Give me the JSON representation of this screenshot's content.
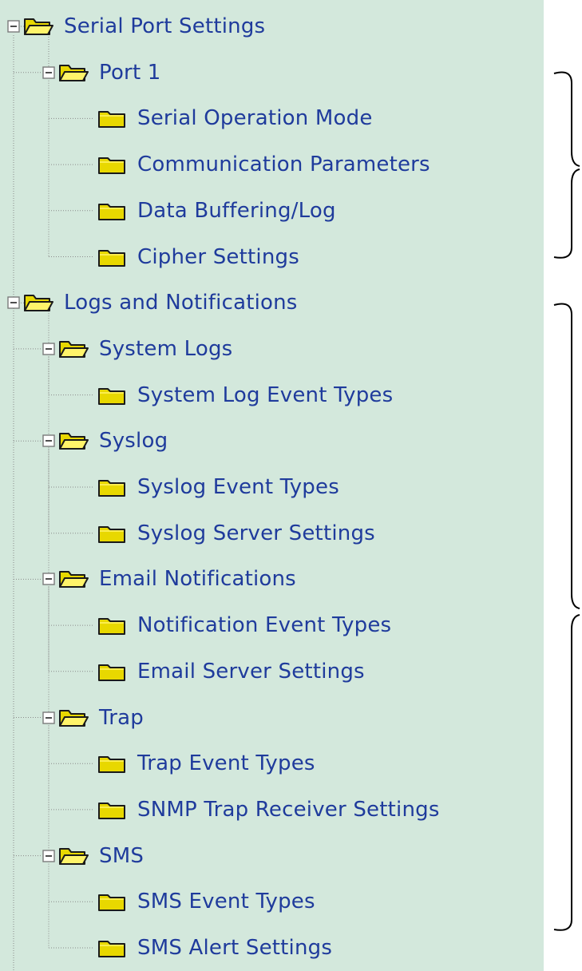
{
  "colors": {
    "panel_background": "#d3e8dc",
    "link_text": "#1f3b9c",
    "folder_fill": "#e8d800",
    "folder_outline": "#1a1a1a",
    "tree_line": "#8a8a8a",
    "bracket_line": "#000000"
  },
  "tree": {
    "items": [
      {
        "label": "Serial Port Settings",
        "level": 0,
        "expandable": true,
        "expanded": true,
        "icon": "folder-open-icon"
      },
      {
        "label": "Port 1",
        "level": 1,
        "expandable": true,
        "expanded": true,
        "icon": "folder-open-icon"
      },
      {
        "label": "Serial Operation Mode",
        "level": 2,
        "expandable": false,
        "icon": "folder-closed-icon"
      },
      {
        "label": "Communication Parameters",
        "level": 2,
        "expandable": false,
        "icon": "folder-closed-icon"
      },
      {
        "label": "Data Buffering/Log",
        "level": 2,
        "expandable": false,
        "icon": "folder-closed-icon"
      },
      {
        "label": "Cipher Settings",
        "level": 2,
        "expandable": false,
        "icon": "folder-closed-icon"
      },
      {
        "label": "Logs and Notifications",
        "level": 0,
        "expandable": true,
        "expanded": true,
        "icon": "folder-open-icon"
      },
      {
        "label": "System Logs",
        "level": 1,
        "expandable": true,
        "expanded": true,
        "icon": "folder-open-icon"
      },
      {
        "label": "System Log Event Types",
        "level": 2,
        "expandable": false,
        "icon": "folder-closed-icon"
      },
      {
        "label": "Syslog",
        "level": 1,
        "expandable": true,
        "expanded": true,
        "icon": "folder-open-icon"
      },
      {
        "label": "Syslog Event Types",
        "level": 2,
        "expandable": false,
        "icon": "folder-closed-icon"
      },
      {
        "label": "Syslog Server Settings",
        "level": 2,
        "expandable": false,
        "icon": "folder-closed-icon"
      },
      {
        "label": "Email Notifications",
        "level": 1,
        "expandable": true,
        "expanded": true,
        "icon": "folder-open-icon"
      },
      {
        "label": "Notification Event Types",
        "level": 2,
        "expandable": false,
        "icon": "folder-closed-icon"
      },
      {
        "label": "Email Server Settings",
        "level": 2,
        "expandable": false,
        "icon": "folder-closed-icon"
      },
      {
        "label": "Trap",
        "level": 1,
        "expandable": true,
        "expanded": true,
        "icon": "folder-open-icon"
      },
      {
        "label": "Trap Event Types",
        "level": 2,
        "expandable": false,
        "icon": "folder-closed-icon"
      },
      {
        "label": "SNMP Trap Receiver Settings",
        "level": 2,
        "expandable": false,
        "icon": "folder-closed-icon"
      },
      {
        "label": "SMS",
        "level": 1,
        "expandable": true,
        "expanded": true,
        "icon": "folder-open-icon"
      },
      {
        "label": "SMS Event Types",
        "level": 2,
        "expandable": false,
        "icon": "folder-closed-icon"
      },
      {
        "label": "SMS Alert Settings",
        "level": 2,
        "expandable": false,
        "icon": "folder-closed-icon"
      }
    ]
  }
}
